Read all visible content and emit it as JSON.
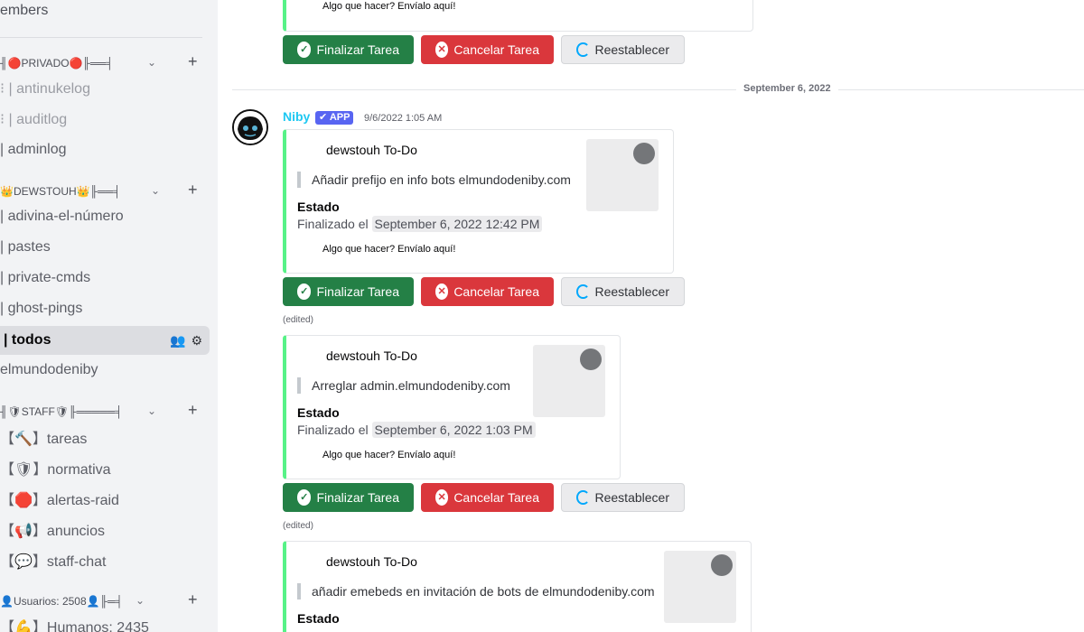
{
  "sidebar": {
    "members_label": "embers",
    "categories": [
      {
        "label": "╢🔴PRIVADO🔴╟══╡"
      },
      {
        "label": "👑DEWSTOUH👑╟══╡"
      },
      {
        "label": "╢🛡STAFF🛡╟═════╡"
      },
      {
        "label": "👤Usuarios: 2508👤╟═╡"
      }
    ],
    "channels": [
      {
        "label": "⁝ | antinukelog"
      },
      {
        "label": "⁝ | auditlog"
      },
      {
        "label": "| adminlog"
      },
      {
        "label": "| adivina-el-número"
      },
      {
        "label": "| pastes"
      },
      {
        "label": "| private-cmds"
      },
      {
        "label": "| ghost-pings"
      },
      {
        "label": "| todos"
      },
      {
        "label": "elmundodeniby"
      },
      {
        "label": "【🔨】tareas"
      },
      {
        "label": "【🛡】normativa"
      },
      {
        "label": "【🛑】alertas-raid"
      },
      {
        "label": "【📢】anuncios"
      },
      {
        "label": "【💬】staff-chat"
      },
      {
        "label": "【💪】Humanos: 2435"
      }
    ]
  },
  "message": {
    "date_separator": "September 6, 2022",
    "author": "Niby",
    "badge": "✔ APP",
    "timestamp": "9/6/2022 1:05 AM",
    "edited_label": "(edited)"
  },
  "buttons": {
    "finish": "Finalizar Tarea",
    "cancel": "Cancelar Tarea",
    "reset": "Reestablecer"
  },
  "embeds": [
    {
      "footer": "Algo que hacer? Envíalo aquí!"
    },
    {
      "title": "dewstouh To-Do",
      "description": "Añadir prefijo en info bots elmundodeniby.com",
      "field_name": "Estado",
      "field_prefix": "Finalizado el",
      "field_time": "September 6, 2022 12:42 PM",
      "footer": "Algo que hacer? Envíalo aquí!"
    },
    {
      "title": "dewstouh To-Do",
      "description": "Arreglar admin.elmundodeniby.com",
      "field_name": "Estado",
      "field_prefix": "Finalizado el",
      "field_time": "September 6, 2022 1:03 PM",
      "footer": "Algo que hacer? Envíalo aquí!"
    },
    {
      "title": "dewstouh To-Do",
      "description": "añadir emebeds en invitación de bots de elmundodeniby.com",
      "field_name": "Estado"
    }
  ],
  "colors": {
    "accent_green": "#248046",
    "accent_red": "#da373c",
    "embed_bar": "#57f287",
    "author_color": "#1ec8f2",
    "app_badge": "#5865f2"
  }
}
